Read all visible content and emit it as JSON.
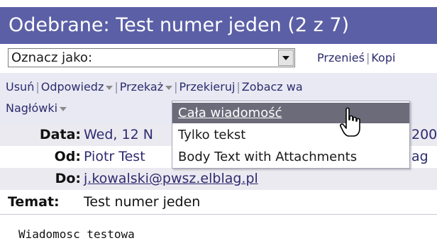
{
  "window": {
    "title": "Odebrane: Test numer jeden (2 z 7)"
  },
  "mark_as": {
    "placeholder": "Oznacz jako:"
  },
  "quick_actions": {
    "move": "Przenieś",
    "copy": "Kopi"
  },
  "toolbar": {
    "delete": "Usuń",
    "reply": "Odpowiedz",
    "forward": "Przekaż",
    "redirect": "Przekieruj",
    "view": "Zobacz wa",
    "headers": "Nagłówki"
  },
  "forward_menu": {
    "items": [
      {
        "label": "Cała wiadomość"
      },
      {
        "label": "Tylko tekst"
      },
      {
        "label": "Body Text with Attachments"
      }
    ]
  },
  "message_headers": {
    "date_label": "Data:",
    "date_value": "Wed, 12 N",
    "date_tail": "200",
    "from_label": "Od:",
    "from_value": "Piotr Test",
    "from_tail": "ag",
    "to_label": "Do:",
    "to_value": "j.kowalski@pwsz.elblag.pl",
    "subject_label": "Temat:",
    "subject_value": "Test numer jeden"
  },
  "message_body": {
    "text": "Wiadomosc testowa"
  },
  "colors": {
    "title_bar": "#5b5fa6",
    "toolbar_bg": "#e8e9f2",
    "link_text": "#2c2c6f",
    "menu_highlight": "#6c6b7a"
  },
  "icons": {
    "cursor": "hand-pointer-icon",
    "select_arrow": "chevron-down-icon"
  }
}
